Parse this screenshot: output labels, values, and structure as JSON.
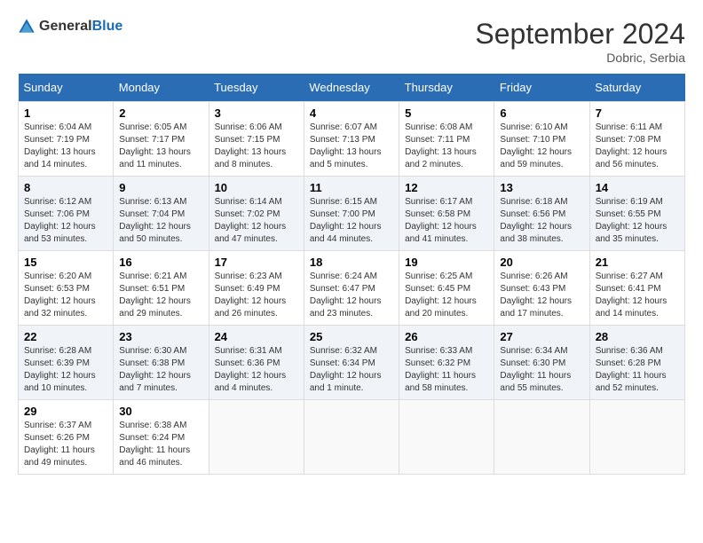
{
  "header": {
    "logo_general": "General",
    "logo_blue": "Blue",
    "title": "September 2024",
    "location": "Dobric, Serbia"
  },
  "days_of_week": [
    "Sunday",
    "Monday",
    "Tuesday",
    "Wednesday",
    "Thursday",
    "Friday",
    "Saturday"
  ],
  "weeks": [
    [
      {
        "day": "1",
        "info": "Sunrise: 6:04 AM\nSunset: 7:19 PM\nDaylight: 13 hours and 14 minutes."
      },
      {
        "day": "2",
        "info": "Sunrise: 6:05 AM\nSunset: 7:17 PM\nDaylight: 13 hours and 11 minutes."
      },
      {
        "day": "3",
        "info": "Sunrise: 6:06 AM\nSunset: 7:15 PM\nDaylight: 13 hours and 8 minutes."
      },
      {
        "day": "4",
        "info": "Sunrise: 6:07 AM\nSunset: 7:13 PM\nDaylight: 13 hours and 5 minutes."
      },
      {
        "day": "5",
        "info": "Sunrise: 6:08 AM\nSunset: 7:11 PM\nDaylight: 13 hours and 2 minutes."
      },
      {
        "day": "6",
        "info": "Sunrise: 6:10 AM\nSunset: 7:10 PM\nDaylight: 12 hours and 59 minutes."
      },
      {
        "day": "7",
        "info": "Sunrise: 6:11 AM\nSunset: 7:08 PM\nDaylight: 12 hours and 56 minutes."
      }
    ],
    [
      {
        "day": "8",
        "info": "Sunrise: 6:12 AM\nSunset: 7:06 PM\nDaylight: 12 hours and 53 minutes."
      },
      {
        "day": "9",
        "info": "Sunrise: 6:13 AM\nSunset: 7:04 PM\nDaylight: 12 hours and 50 minutes."
      },
      {
        "day": "10",
        "info": "Sunrise: 6:14 AM\nSunset: 7:02 PM\nDaylight: 12 hours and 47 minutes."
      },
      {
        "day": "11",
        "info": "Sunrise: 6:15 AM\nSunset: 7:00 PM\nDaylight: 12 hours and 44 minutes."
      },
      {
        "day": "12",
        "info": "Sunrise: 6:17 AM\nSunset: 6:58 PM\nDaylight: 12 hours and 41 minutes."
      },
      {
        "day": "13",
        "info": "Sunrise: 6:18 AM\nSunset: 6:56 PM\nDaylight: 12 hours and 38 minutes."
      },
      {
        "day": "14",
        "info": "Sunrise: 6:19 AM\nSunset: 6:55 PM\nDaylight: 12 hours and 35 minutes."
      }
    ],
    [
      {
        "day": "15",
        "info": "Sunrise: 6:20 AM\nSunset: 6:53 PM\nDaylight: 12 hours and 32 minutes."
      },
      {
        "day": "16",
        "info": "Sunrise: 6:21 AM\nSunset: 6:51 PM\nDaylight: 12 hours and 29 minutes."
      },
      {
        "day": "17",
        "info": "Sunrise: 6:23 AM\nSunset: 6:49 PM\nDaylight: 12 hours and 26 minutes."
      },
      {
        "day": "18",
        "info": "Sunrise: 6:24 AM\nSunset: 6:47 PM\nDaylight: 12 hours and 23 minutes."
      },
      {
        "day": "19",
        "info": "Sunrise: 6:25 AM\nSunset: 6:45 PM\nDaylight: 12 hours and 20 minutes."
      },
      {
        "day": "20",
        "info": "Sunrise: 6:26 AM\nSunset: 6:43 PM\nDaylight: 12 hours and 17 minutes."
      },
      {
        "day": "21",
        "info": "Sunrise: 6:27 AM\nSunset: 6:41 PM\nDaylight: 12 hours and 14 minutes."
      }
    ],
    [
      {
        "day": "22",
        "info": "Sunrise: 6:28 AM\nSunset: 6:39 PM\nDaylight: 12 hours and 10 minutes."
      },
      {
        "day": "23",
        "info": "Sunrise: 6:30 AM\nSunset: 6:38 PM\nDaylight: 12 hours and 7 minutes."
      },
      {
        "day": "24",
        "info": "Sunrise: 6:31 AM\nSunset: 6:36 PM\nDaylight: 12 hours and 4 minutes."
      },
      {
        "day": "25",
        "info": "Sunrise: 6:32 AM\nSunset: 6:34 PM\nDaylight: 12 hours and 1 minute."
      },
      {
        "day": "26",
        "info": "Sunrise: 6:33 AM\nSunset: 6:32 PM\nDaylight: 11 hours and 58 minutes."
      },
      {
        "day": "27",
        "info": "Sunrise: 6:34 AM\nSunset: 6:30 PM\nDaylight: 11 hours and 55 minutes."
      },
      {
        "day": "28",
        "info": "Sunrise: 6:36 AM\nSunset: 6:28 PM\nDaylight: 11 hours and 52 minutes."
      }
    ],
    [
      {
        "day": "29",
        "info": "Sunrise: 6:37 AM\nSunset: 6:26 PM\nDaylight: 11 hours and 49 minutes."
      },
      {
        "day": "30",
        "info": "Sunrise: 6:38 AM\nSunset: 6:24 PM\nDaylight: 11 hours and 46 minutes."
      },
      {
        "day": "",
        "info": ""
      },
      {
        "day": "",
        "info": ""
      },
      {
        "day": "",
        "info": ""
      },
      {
        "day": "",
        "info": ""
      },
      {
        "day": "",
        "info": ""
      }
    ]
  ]
}
